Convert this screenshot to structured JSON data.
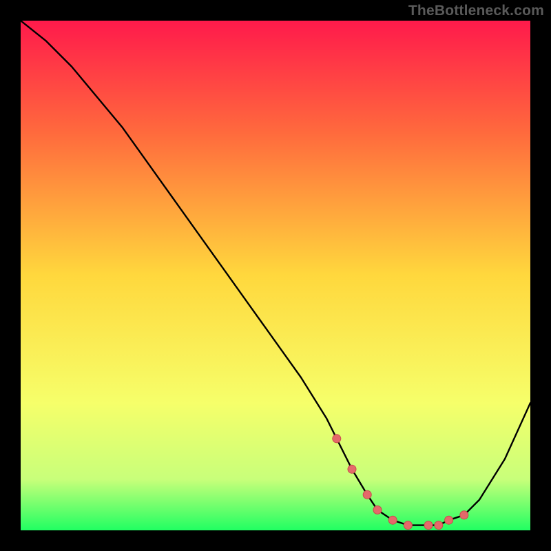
{
  "watermark": "TheBottleneck.com",
  "colors": {
    "background": "#000000",
    "watermark_text": "#5a5a5a",
    "gradient_top": "#ff1a4b",
    "gradient_upper_mid": "#ff6a3d",
    "gradient_mid": "#ffd83d",
    "gradient_lower_mid": "#f6ff6a",
    "gradient_low": "#c8ff7a",
    "gradient_bottom": "#21ff62",
    "curve_stroke": "#000000",
    "marker_fill": "#e46a6a",
    "marker_stroke": "#c94b4b"
  },
  "chart_data": {
    "type": "line",
    "title": "",
    "xlabel": "",
    "ylabel": "",
    "xlim": [
      0,
      100
    ],
    "ylim": [
      0,
      100
    ],
    "series": [
      {
        "name": "bottleneck-curve",
        "x": [
          0,
          5,
          10,
          15,
          20,
          25,
          30,
          35,
          40,
          45,
          50,
          55,
          60,
          62,
          65,
          68,
          70,
          73,
          76,
          80,
          82,
          84,
          87,
          90,
          95,
          100
        ],
        "y": [
          100,
          96,
          91,
          85,
          79,
          72,
          65,
          58,
          51,
          44,
          37,
          30,
          22,
          18,
          12,
          7,
          4,
          2,
          1,
          1,
          1,
          2,
          3,
          6,
          14,
          25
        ]
      }
    ],
    "markers": {
      "name": "highlighted-range",
      "x": [
        62,
        65,
        68,
        70,
        73,
        76,
        80,
        82,
        84,
        87
      ],
      "y": [
        18,
        12,
        7,
        4,
        2,
        1,
        1,
        1,
        2,
        3
      ]
    }
  }
}
